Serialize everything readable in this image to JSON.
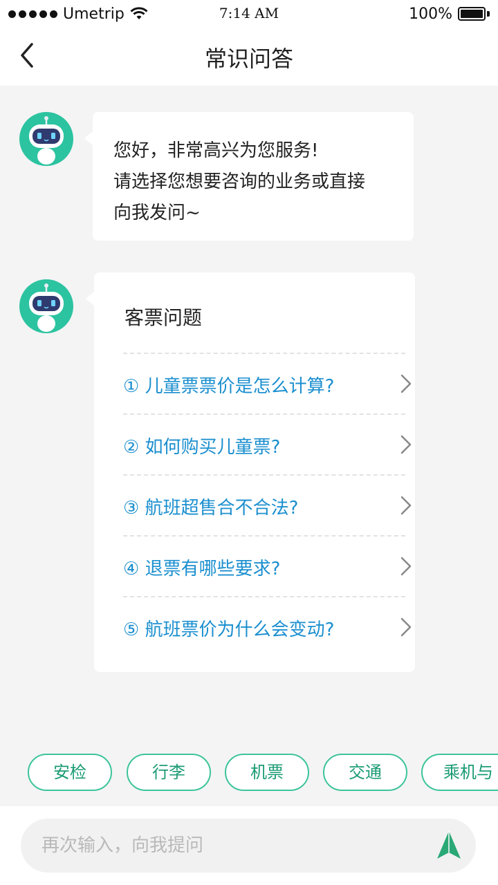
{
  "status_bar": {
    "carrier": "Umetrip",
    "time": "7:14 AM",
    "battery": "100%"
  },
  "nav": {
    "title": "常识问答"
  },
  "greeting": {
    "lines": [
      "您好，非常高兴为您服务!",
      "请选择您想要咨询的业务或直接",
      "向我发问~"
    ]
  },
  "faq": {
    "title": "客票问题",
    "items": [
      {
        "label": "① 儿童票票价是怎么计算?"
      },
      {
        "label": "② 如何购买儿童票?"
      },
      {
        "label": "③ 航班超售合不合法?"
      },
      {
        "label": "④  退票有哪些要求?"
      },
      {
        "label": "⑤  航班票价为什么会变动?"
      }
    ]
  },
  "quick_tags": [
    "安检",
    "行李",
    "机票",
    "交通",
    "乘机与"
  ],
  "input": {
    "placeholder": "再次输入，向我提问"
  },
  "colors": {
    "accent_green": "#3cc49a",
    "link_blue": "#1b8fcf",
    "background": "#f4f4f4"
  }
}
